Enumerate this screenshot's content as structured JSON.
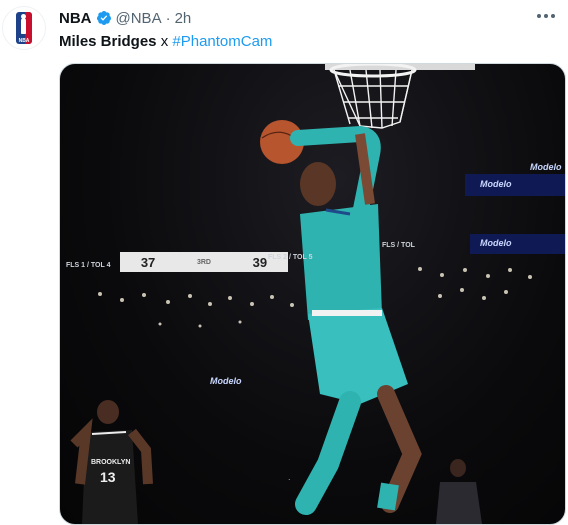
{
  "tweet": {
    "author_name": "NBA",
    "handle": "@NBA",
    "separator": "·",
    "time": "2h",
    "text_bold": "Miles Bridges",
    "text_mid": " x ",
    "hashtag": "#PhantomCam"
  },
  "media": {
    "scoreboard": {
      "left_score": "37",
      "right_score": "39",
      "mid_text": "3RD"
    },
    "tags": [
      "FLS 1 / TOL 4",
      "FLS / TOL",
      "FLS 2 / TOL 5"
    ],
    "signs": [
      "Modelo",
      "Modelo",
      "Modelo",
      "Modelo"
    ],
    "player_back_number": "13",
    "player_back_text": "BROOKLYN"
  },
  "colors": {
    "accent": "#1d9bf0",
    "teal_jersey": "#2fb3b0",
    "verified": "#1d9bf0"
  },
  "icons": [
    "nba-logo-icon",
    "verified-badge-icon",
    "more-options-icon"
  ]
}
